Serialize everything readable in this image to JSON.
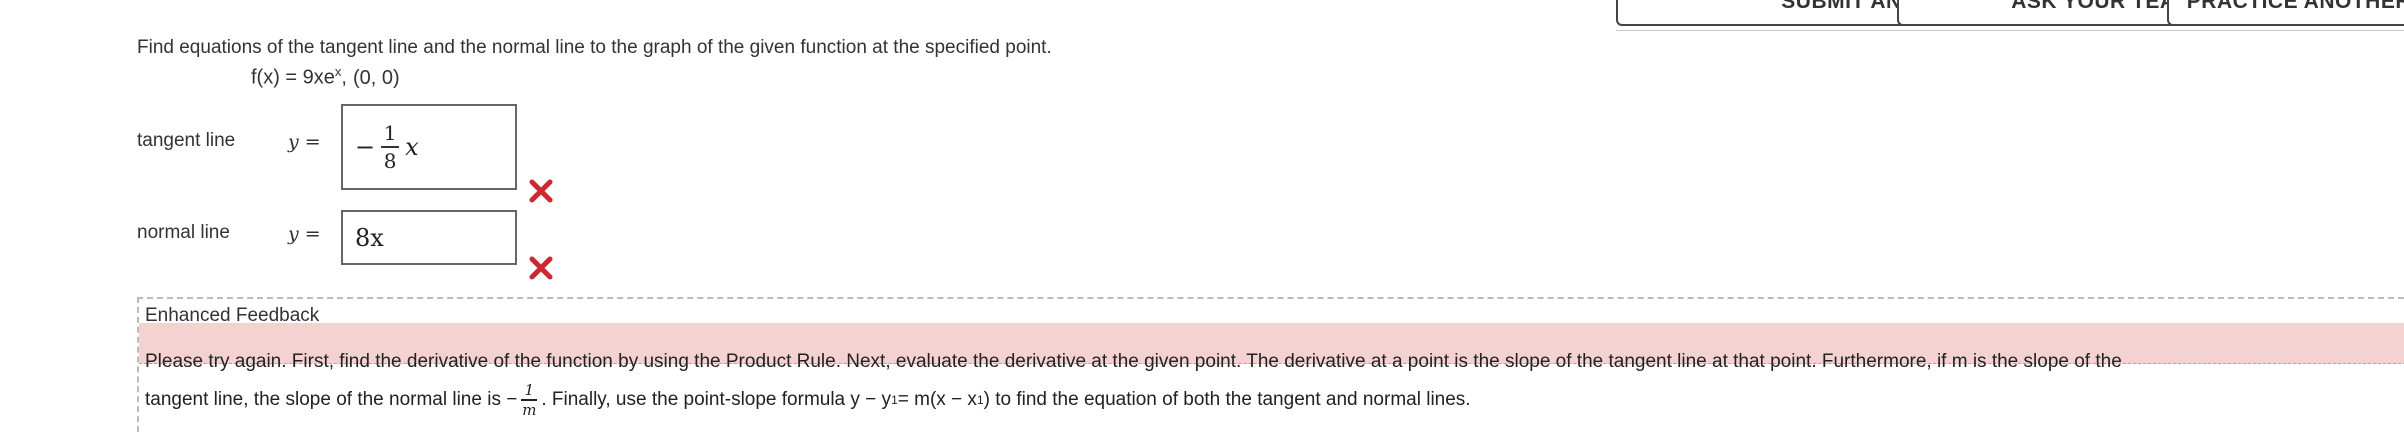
{
  "top_buttons": {
    "submit": "Submit Answer",
    "ask_teacher": "Ask Your Teacher",
    "practice": "Practice Another"
  },
  "question": {
    "prompt": "Find equations of the tangent line and the normal line to the graph of the given function at the specified point.",
    "function_lhs": "f(x) = 9xe",
    "function_exp": "x",
    "point": "(0, 0)"
  },
  "tangent": {
    "label": "tangent line",
    "y_eq": "y =",
    "answer_minus": "−",
    "answer_num": "1",
    "answer_den": "8",
    "answer_var": "x",
    "status": "incorrect"
  },
  "normal": {
    "label": "normal line",
    "y_eq": "y =",
    "answer": "8x",
    "status": "incorrect"
  },
  "feedback": {
    "title": "Enhanced Feedback",
    "line1": "Please try again. First, find the derivative of the function by using the Product Rule. Next, evaluate the derivative at the given point. The derivative at a point is the slope of the tangent line at that point. Furthermore, if m is the slope of the",
    "line2_a": "tangent line, the slope of the normal line is −",
    "line2_frac_num": "1",
    "line2_frac_den": "m",
    "line2_b": ". Finally, use the point-slope formula y − y",
    "line2_sub1": "1",
    "line2_c": " = m(x − x",
    "line2_sub2": "1",
    "line2_d": ") to find the equation of both the tangent and normal lines."
  },
  "colors": {
    "error_red": "#d0262e",
    "feedback_band": "#f4d2d2"
  }
}
